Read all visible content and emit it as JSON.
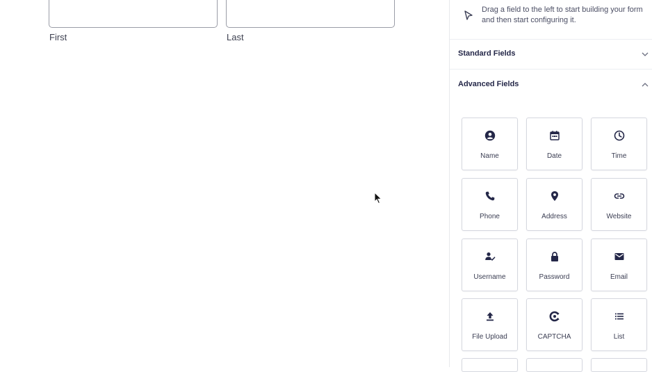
{
  "form": {
    "name_field": {
      "first_label": "First",
      "last_label": "Last"
    }
  },
  "sidebar": {
    "hint": "Drag a field to the left to start building your form and then start configuring it.",
    "sections": {
      "standard": {
        "title": "Standard Fields",
        "expanded": false
      },
      "advanced": {
        "title": "Advanced Fields",
        "expanded": true
      }
    },
    "advanced_fields": [
      {
        "label": "Name",
        "icon": "user-circle-icon"
      },
      {
        "label": "Date",
        "icon": "calendar-icon"
      },
      {
        "label": "Time",
        "icon": "clock-icon"
      },
      {
        "label": "Phone",
        "icon": "phone-icon"
      },
      {
        "label": "Address",
        "icon": "map-pin-icon"
      },
      {
        "label": "Website",
        "icon": "link-icon"
      },
      {
        "label": "Username",
        "icon": "user-check-icon"
      },
      {
        "label": "Password",
        "icon": "lock-icon"
      },
      {
        "label": "Email",
        "icon": "envelope-icon"
      },
      {
        "label": "File Upload",
        "icon": "upload-icon"
      },
      {
        "label": "CAPTCHA",
        "icon": "captcha-icon"
      },
      {
        "label": "List",
        "icon": "list-icon"
      }
    ]
  },
  "colors": {
    "text_dark": "#242748",
    "border": "#d5d7df",
    "icon": "#242748"
  }
}
